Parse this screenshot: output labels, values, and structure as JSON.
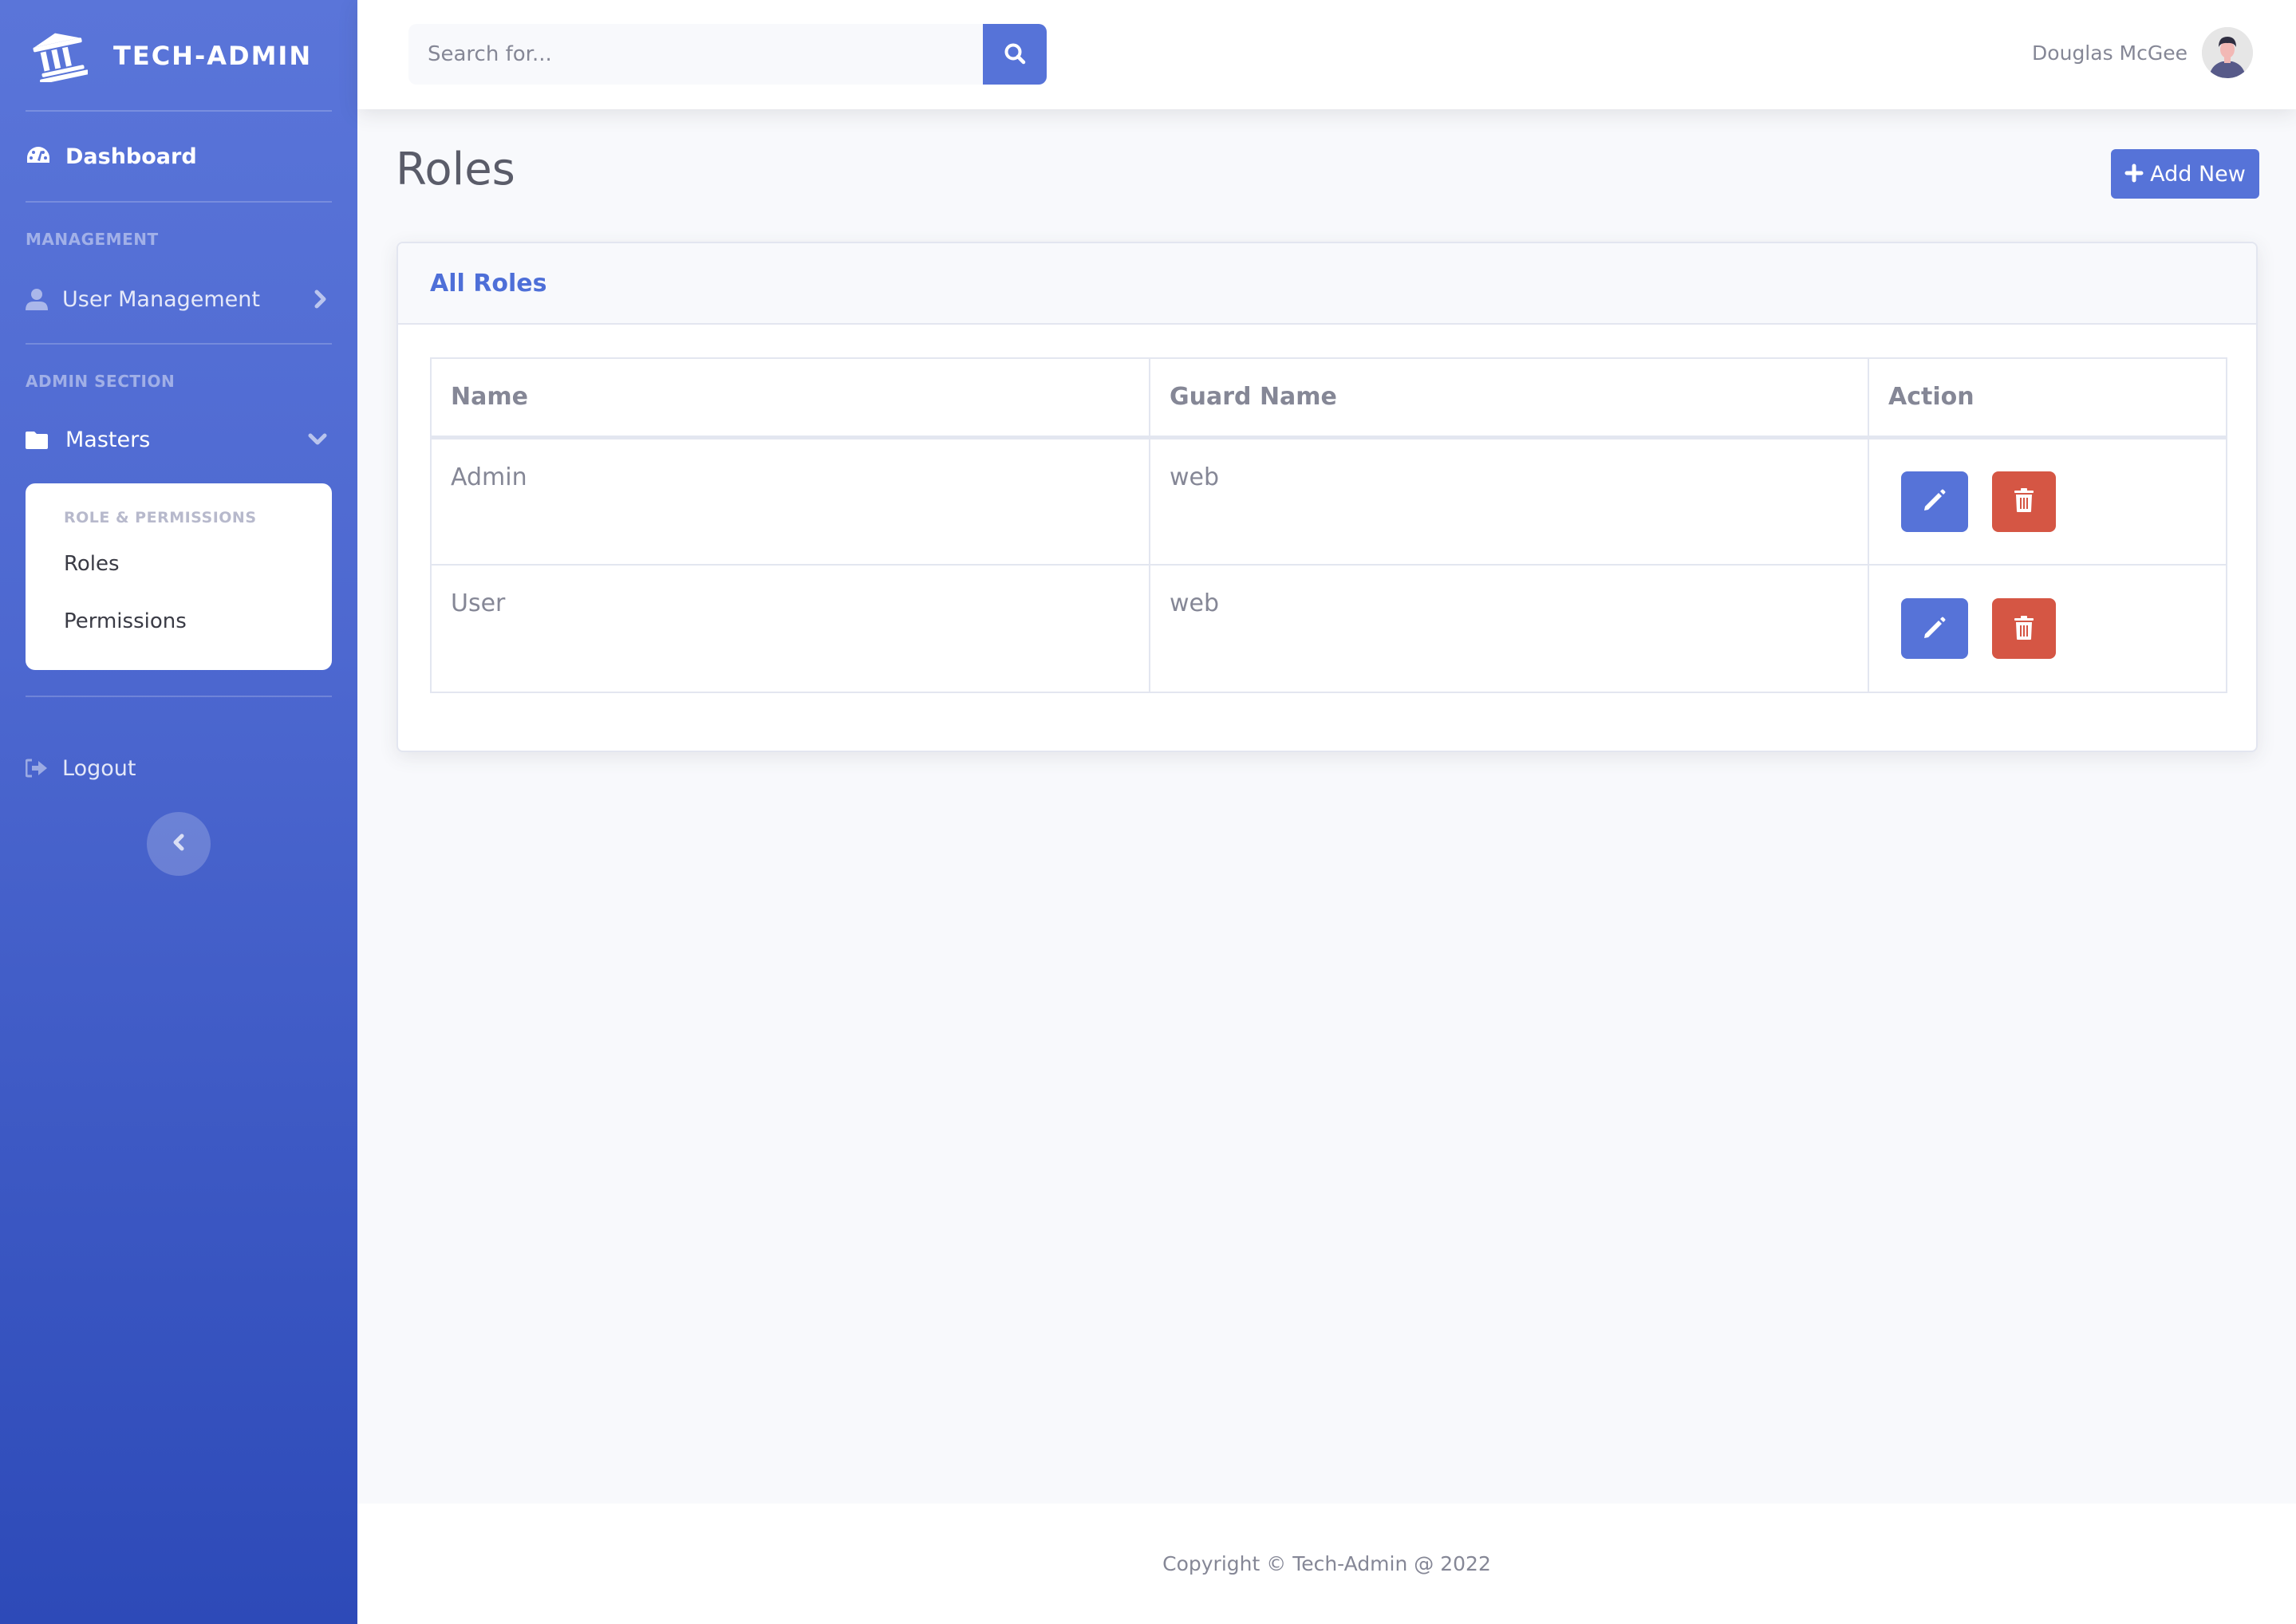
{
  "app": {
    "brand_name": "TECH-ADMIN",
    "brand_icon": "landmark-icon"
  },
  "sidebar": {
    "dashboard": {
      "label": "Dashboard",
      "icon": "tachometer-icon"
    },
    "headings": {
      "management": "MANAGEMENT",
      "admin_section": "ADMIN SECTION"
    },
    "user_management": {
      "label": "User Management",
      "icon": "user-icon",
      "chevron": "chevron-right-icon"
    },
    "masters": {
      "label": "Masters",
      "icon": "folder-icon",
      "chevron": "chevron-down-icon",
      "expanded": true,
      "submenu": {
        "heading": "ROLE & PERMISSIONS",
        "items": [
          {
            "label": "Roles",
            "active": true
          },
          {
            "label": "Permissions",
            "active": false
          }
        ]
      }
    },
    "logout": {
      "label": "Logout",
      "icon": "sign-out-icon"
    },
    "toggle_icon": "chevron-left-icon"
  },
  "topbar": {
    "search": {
      "placeholder": "Search for...",
      "value": "",
      "button_icon": "search-icon"
    },
    "user": {
      "name": "Douglas McGee",
      "avatar": "avatar-illustration"
    }
  },
  "main": {
    "page_title": "Roles",
    "add_button": {
      "label": "Add New",
      "icon": "plus-icon"
    },
    "card": {
      "title": "All Roles",
      "table": {
        "columns": [
          "Name",
          "Guard Name",
          "Action"
        ],
        "rows": [
          {
            "name": "Admin",
            "guard_name": "web",
            "actions": [
              "edit",
              "delete"
            ]
          },
          {
            "name": "User",
            "guard_name": "web",
            "actions": [
              "edit",
              "delete"
            ]
          }
        ]
      }
    }
  },
  "footer": {
    "copyright": "Copyright © Tech-Admin @ 2022"
  },
  "colors": {
    "primary": "#5673d8",
    "danger": "#d55644",
    "sidebar_top": "#5a75d9",
    "sidebar_bottom": "#2d4ab8",
    "text_muted": "#858796",
    "page_bg": "#f8f9fc"
  }
}
